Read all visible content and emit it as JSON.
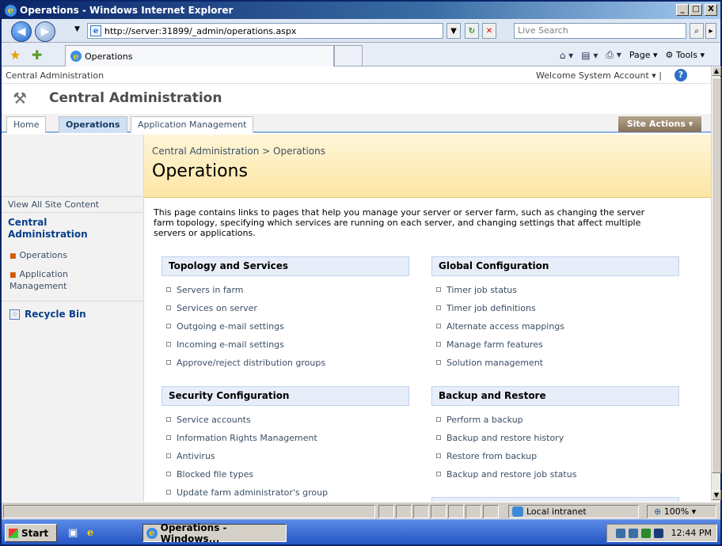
{
  "window": {
    "title": "Operations - Windows Internet Explorer",
    "minimize": "_",
    "maximize": "□",
    "close": "X"
  },
  "browser": {
    "address": "http://server:31899/_admin/operations.aspx",
    "search_placeholder": "Live Search",
    "tab_title": "Operations",
    "page_menu": "Page",
    "tools_menu": "Tools"
  },
  "page": {
    "top_breadcrumb": "Central Administration",
    "welcome": "Welcome System Account",
    "site_title": "Central Administration",
    "nav_tabs": [
      "Home",
      "Operations",
      "Application Management"
    ],
    "site_actions": "Site Actions",
    "breadcrumb": "Central Administration > Operations",
    "page_title": "Operations",
    "description": "This page contains links to pages that help you manage your server or server farm, such as changing the server farm topology, specifying which services are running on each server, and changing settings that affect multiple servers or applications.",
    "left_nav": {
      "view_all": "View All Site Content",
      "heading": "Central Administration",
      "items": [
        "Operations",
        "Application Management"
      ],
      "recycle_bin": "Recycle Bin"
    },
    "groups": [
      {
        "title": "Topology and Services",
        "links": [
          "Servers in farm",
          "Services on server",
          "Outgoing e-mail settings",
          "Incoming e-mail settings",
          "Approve/reject distribution groups"
        ]
      },
      {
        "title": "Global Configuration",
        "links": [
          "Timer job status",
          "Timer job definitions",
          "Alternate access mappings",
          "Manage farm features",
          "Solution management"
        ]
      },
      {
        "title": "Security Configuration",
        "links": [
          "Service accounts",
          "Information Rights Management",
          "Antivirus",
          "Blocked file types",
          "Update farm administrator's group"
        ]
      },
      {
        "title": "Backup and Restore",
        "links": [
          "Perform a backup",
          "Backup and restore history",
          "Restore from backup",
          "Backup and restore job status"
        ]
      }
    ]
  },
  "status": {
    "zone": "Local intranet",
    "zoom": "100%"
  },
  "taskbar": {
    "start": "Start",
    "task": "Operations - Windows...",
    "time": "12:44 PM"
  }
}
